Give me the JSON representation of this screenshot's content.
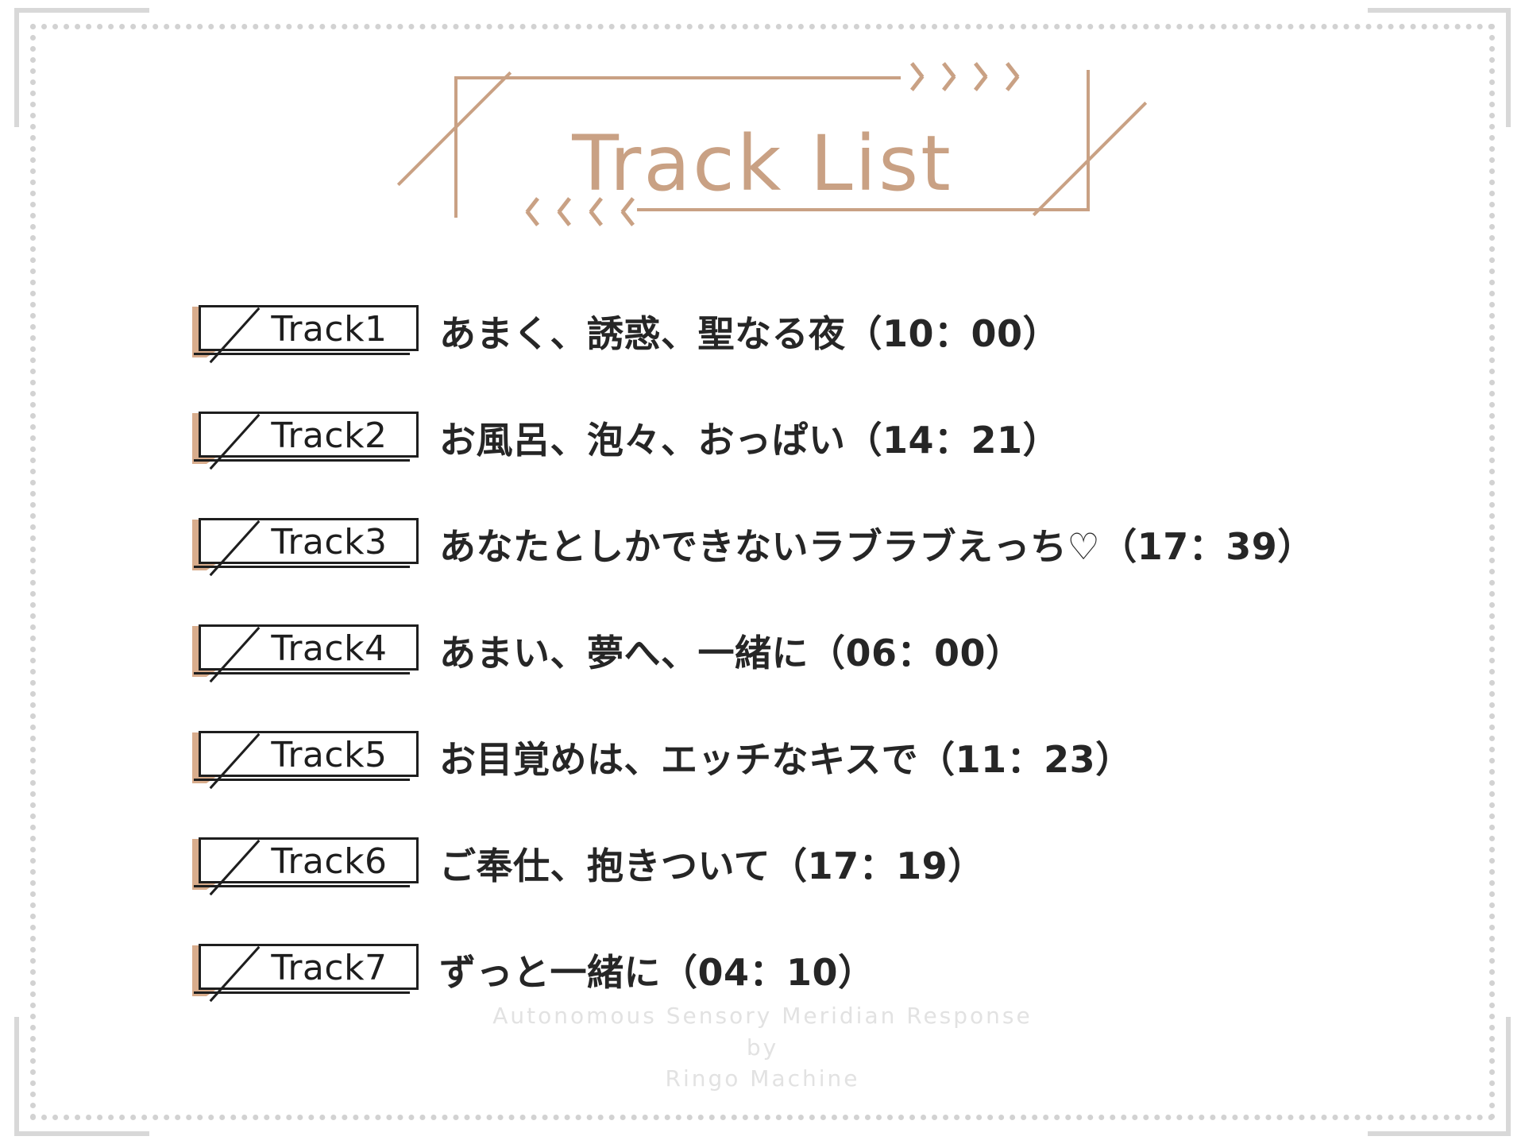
{
  "header": {
    "title": "Track List",
    "chevrons_right": [
      ">",
      ">",
      ">",
      ">"
    ],
    "chevrons_left": [
      "<",
      "<",
      "<",
      "<"
    ],
    "accent_color": "#c9a184"
  },
  "tracks": [
    {
      "badge": "Track1",
      "title": "あまく、誘惑、聖なる夜（10：00）"
    },
    {
      "badge": "Track2",
      "title": "お風呂、泡々、おっぱい（14：21）"
    },
    {
      "badge": "Track3",
      "title": "あなたとしかできないラブラブえっち♡（17：39）"
    },
    {
      "badge": "Track4",
      "title": "あまい、夢へ、一緒に（06：00）"
    },
    {
      "badge": "Track5",
      "title": "お目覚めは、エッチなキスで（11：23）"
    },
    {
      "badge": "Track6",
      "title": "ご奉仕、抱きついて（17：19）"
    },
    {
      "badge": "Track7",
      "title": "ずっと一緒に（04：10）"
    }
  ],
  "footer": {
    "line1": "Autonomous Sensory Meridian Response",
    "line2": "by",
    "line3": "Ringo Machine"
  },
  "colors": {
    "badge_wedge": "#d8ac8c",
    "title_accent": "#c9a184",
    "text": "#262626",
    "footer_text": "#e2e2e2",
    "frame_grey": "#d8d8d8",
    "dotted_grey": "#d2d2d2"
  }
}
